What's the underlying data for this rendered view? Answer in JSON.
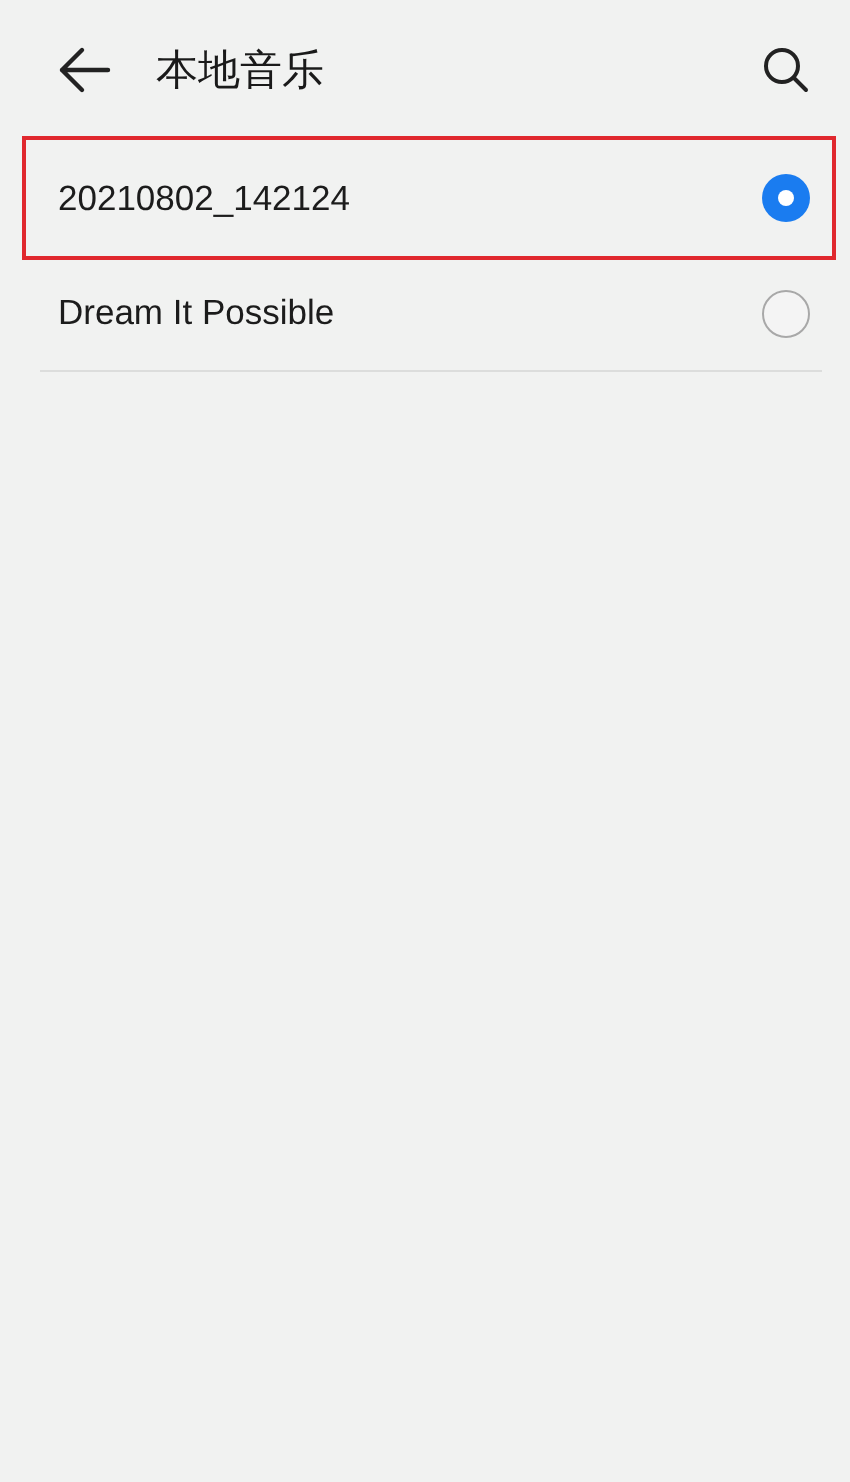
{
  "header": {
    "title": "本地音乐"
  },
  "songs": [
    {
      "title": "20210802_142124",
      "selected": true,
      "highlighted": true
    },
    {
      "title": "Dream It Possible",
      "selected": false,
      "highlighted": false
    }
  ]
}
